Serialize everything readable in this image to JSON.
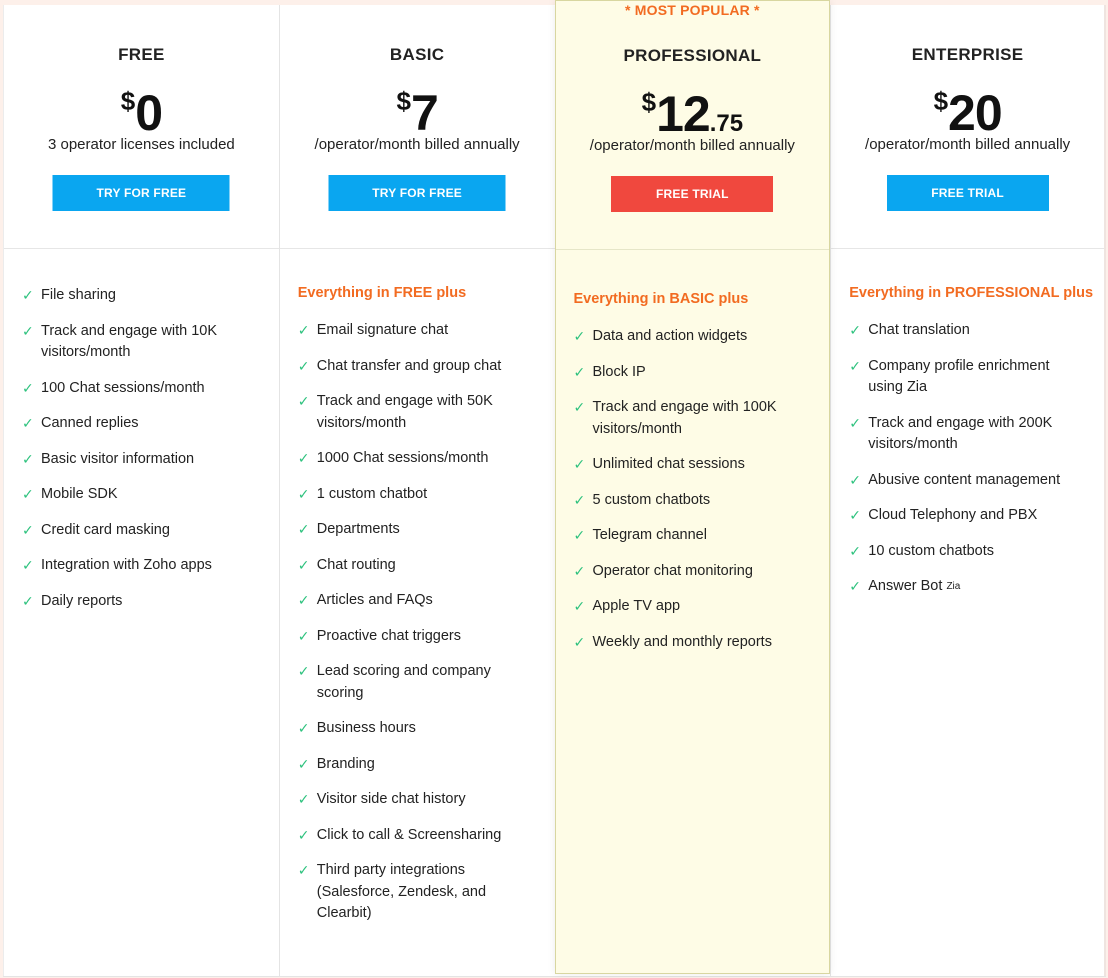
{
  "plans": [
    {
      "id": "free",
      "name": "FREE",
      "currency": "$",
      "price_whole": "0",
      "price_cents": "",
      "subtitle": "3 operator licenses included",
      "button_label": "TRY FOR FREE",
      "button_color": "#0aa6f0",
      "includes_label": "",
      "features": [
        "File sharing",
        "Track and engage with 10K visitors/month",
        "100 Chat sessions/month",
        "Canned replies",
        "Basic visitor information",
        "Mobile SDK",
        "Credit card masking",
        "Integration with Zoho apps",
        "Daily reports"
      ]
    },
    {
      "id": "basic",
      "name": "BASIC",
      "currency": "$",
      "price_whole": "7",
      "price_cents": "",
      "subtitle": "/operator/month billed annually",
      "button_label": "TRY FOR FREE",
      "button_color": "#0aa6f0",
      "includes_label": "Everything in FREE plus",
      "features": [
        "Email signature chat",
        "Chat transfer and group chat",
        "Track and engage with 50K visitors/month",
        "1000 Chat sessions/month",
        "1 custom chatbot",
        "Departments",
        "Chat routing",
        "Articles and FAQs",
        "Proactive chat triggers",
        "Lead scoring and company scoring",
        "Business hours",
        "Branding",
        "Visitor side chat history",
        "Click to call & Screensharing",
        "Third party integrations (Salesforce, Zendesk, and Clearbit)"
      ]
    },
    {
      "id": "professional",
      "name": "PROFESSIONAL",
      "badge": "* MOST POPULAR *",
      "currency": "$",
      "price_whole": "12",
      "price_cents": ".75",
      "subtitle": "/operator/month billed annually",
      "button_label": "FREE TRIAL",
      "button_color": "#f0483e",
      "includes_label": "Everything in BASIC plus",
      "features": [
        "Data and action widgets",
        "Block IP",
        "Track and engage with 100K visitors/month",
        "Unlimited chat sessions",
        "5 custom chatbots",
        "Telegram channel",
        "Operator chat monitoring",
        "Apple TV app",
        "Weekly and monthly reports"
      ]
    },
    {
      "id": "enterprise",
      "name": "ENTERPRISE",
      "currency": "$",
      "price_whole": "20",
      "price_cents": "",
      "subtitle": "/operator/month billed annually",
      "button_label": "FREE TRIAL",
      "button_color": "#0aa6f0",
      "includes_label": "Everything in PROFESSIONAL plus",
      "features": [
        "Chat translation",
        "Company profile enrichment using Zia",
        "Track and engage with 200K visitors/month",
        "Abusive content management",
        "Cloud Telephony and PBX",
        "10 custom chatbots",
        "Answer Bot"
      ],
      "last_feature_superscript": "Zia"
    }
  ],
  "icons": {
    "feature_check": "check-icon ✓"
  },
  "colors": {
    "accent_orange": "#f26b21",
    "check_green": "#2ec27e",
    "popular_bg": "#fefce6"
  }
}
